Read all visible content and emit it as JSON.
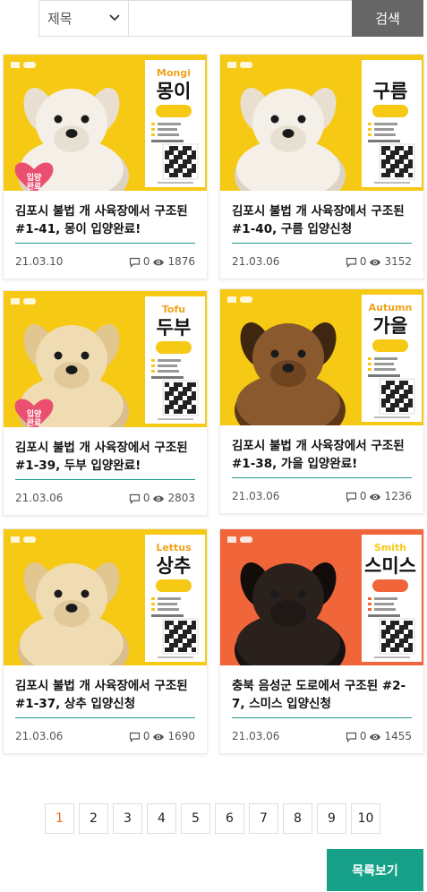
{
  "search": {
    "category_selected": "제목",
    "query_value": "",
    "submit_label": "검색"
  },
  "cards": [
    {
      "title": "김포시 불법 개 사육장에서 구조된 #1-41, 몽이 입양완료!",
      "date": "21.03.10",
      "comments": "0",
      "views": "1876",
      "poster": {
        "name_en": "Mongi",
        "name_ko": "몽이",
        "bg": "#f6c915",
        "badge": "입양완료",
        "dog": "white"
      }
    },
    {
      "title": "김포시 불법 개 사육장에서 구조된 #1-40, 구름 입양신청",
      "date": "21.03.06",
      "comments": "0",
      "views": "3152",
      "poster": {
        "name_en": "",
        "name_ko": "구름",
        "bg": "#f6c915",
        "badge": "",
        "dog": "white"
      }
    },
    {
      "title": "김포시 불법 개 사육장에서 구조된 #1-39, 두부 입양완료!",
      "date": "21.03.06",
      "comments": "0",
      "views": "2803",
      "poster": {
        "name_en": "Tofu",
        "name_ko": "두부",
        "bg": "#f6c915",
        "badge": "입양완료",
        "dog": "cream"
      }
    },
    {
      "title": "김포시 불법 개 사육장에서 구조된 #1-38, 가을 입양완료!",
      "date": "21.03.06",
      "comments": "0",
      "views": "1236",
      "poster": {
        "name_en": "Autumn",
        "name_ko": "가을",
        "bg": "#f6c915",
        "badge": "",
        "dog": "brown"
      }
    },
    {
      "title": "김포시 불법 개 사육장에서 구조된 #1-37, 상추 입양신청",
      "date": "21.03.06",
      "comments": "0",
      "views": "1690",
      "poster": {
        "name_en": "Lettus",
        "name_ko": "상추",
        "bg": "#f6c915",
        "badge": "",
        "dog": "cream"
      }
    },
    {
      "title": "충북 음성군 도로에서 구조된 #2-7, 스미스 입양신청",
      "date": "21.03.06",
      "comments": "0",
      "views": "1455",
      "poster": {
        "name_en": "Smith",
        "name_ko": "스미스",
        "bg": "#f0653a",
        "badge": "",
        "dog": "black"
      }
    }
  ],
  "pagination": {
    "pages": [
      "1",
      "2",
      "3",
      "4",
      "5",
      "6",
      "7",
      "8",
      "9",
      "10"
    ],
    "current": "1"
  },
  "list_button_label": "목록보기",
  "colors": {
    "accent": "#16a087",
    "divider": "#1d9a8c",
    "search_button": "#666666",
    "active_page": "#e36b1d",
    "poster_yellow": "#f6c915",
    "poster_orange": "#f0653a"
  },
  "icons": {
    "comment": "comment-icon",
    "views": "eye-icon",
    "dropdown": "chevron-down-icon"
  }
}
